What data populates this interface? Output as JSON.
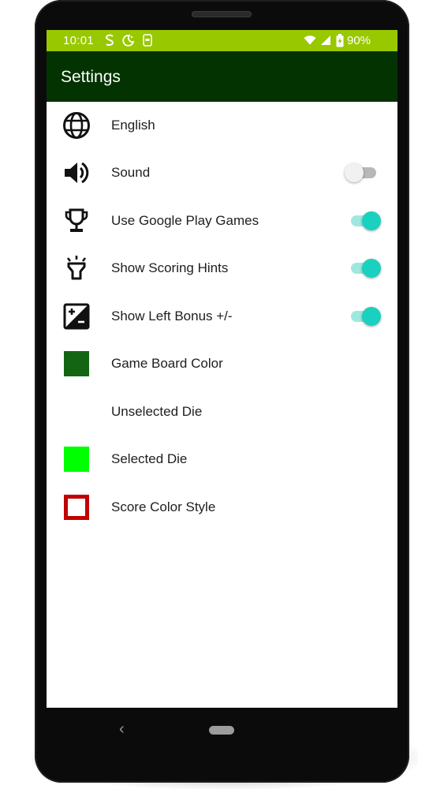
{
  "status_bar": {
    "time": "10:01",
    "battery": "90%",
    "left_icons": [
      "s-app-icon",
      "moon-icon",
      "phone-app-icon"
    ],
    "right_icons": [
      "wifi-icon",
      "signal-icon",
      "battery-charging-icon"
    ],
    "background": "#98c800"
  },
  "app_bar": {
    "title": "Settings",
    "background": "#033300"
  },
  "settings": [
    {
      "label": "English",
      "icon": "globe-icon",
      "control": "none"
    },
    {
      "label": "Sound",
      "icon": "speaker-icon",
      "control": "switch",
      "on": false
    },
    {
      "label": "Use Google Play Games",
      "icon": "trophy-icon",
      "control": "switch",
      "on": true
    },
    {
      "label": "Show Scoring Hints",
      "icon": "lightbulb-icon",
      "control": "switch",
      "on": true
    },
    {
      "label": "Show Left Bonus +/-",
      "icon": "exposure-icon",
      "control": "switch",
      "on": true
    },
    {
      "label": "Game Board Color",
      "icon": "color-swatch",
      "control": "none",
      "color": "#136513"
    },
    {
      "label": "Unselected Die",
      "icon": "color-swatch",
      "control": "none",
      "color": "#ffffff"
    },
    {
      "label": "Selected Die",
      "icon": "color-swatch",
      "control": "none",
      "color": "#00ff00"
    },
    {
      "label": "Score Color Style",
      "icon": "outlined-square-icon",
      "control": "none",
      "color": "#c00000"
    }
  ],
  "switch_colors": {
    "on_thumb": "#1ad1bf",
    "on_track": "#9ee8e0",
    "off_thumb": "#f1f1f1",
    "off_track": "#b8b8b8"
  },
  "nav_bar": {
    "buttons": [
      "back-button",
      "home-button"
    ]
  }
}
